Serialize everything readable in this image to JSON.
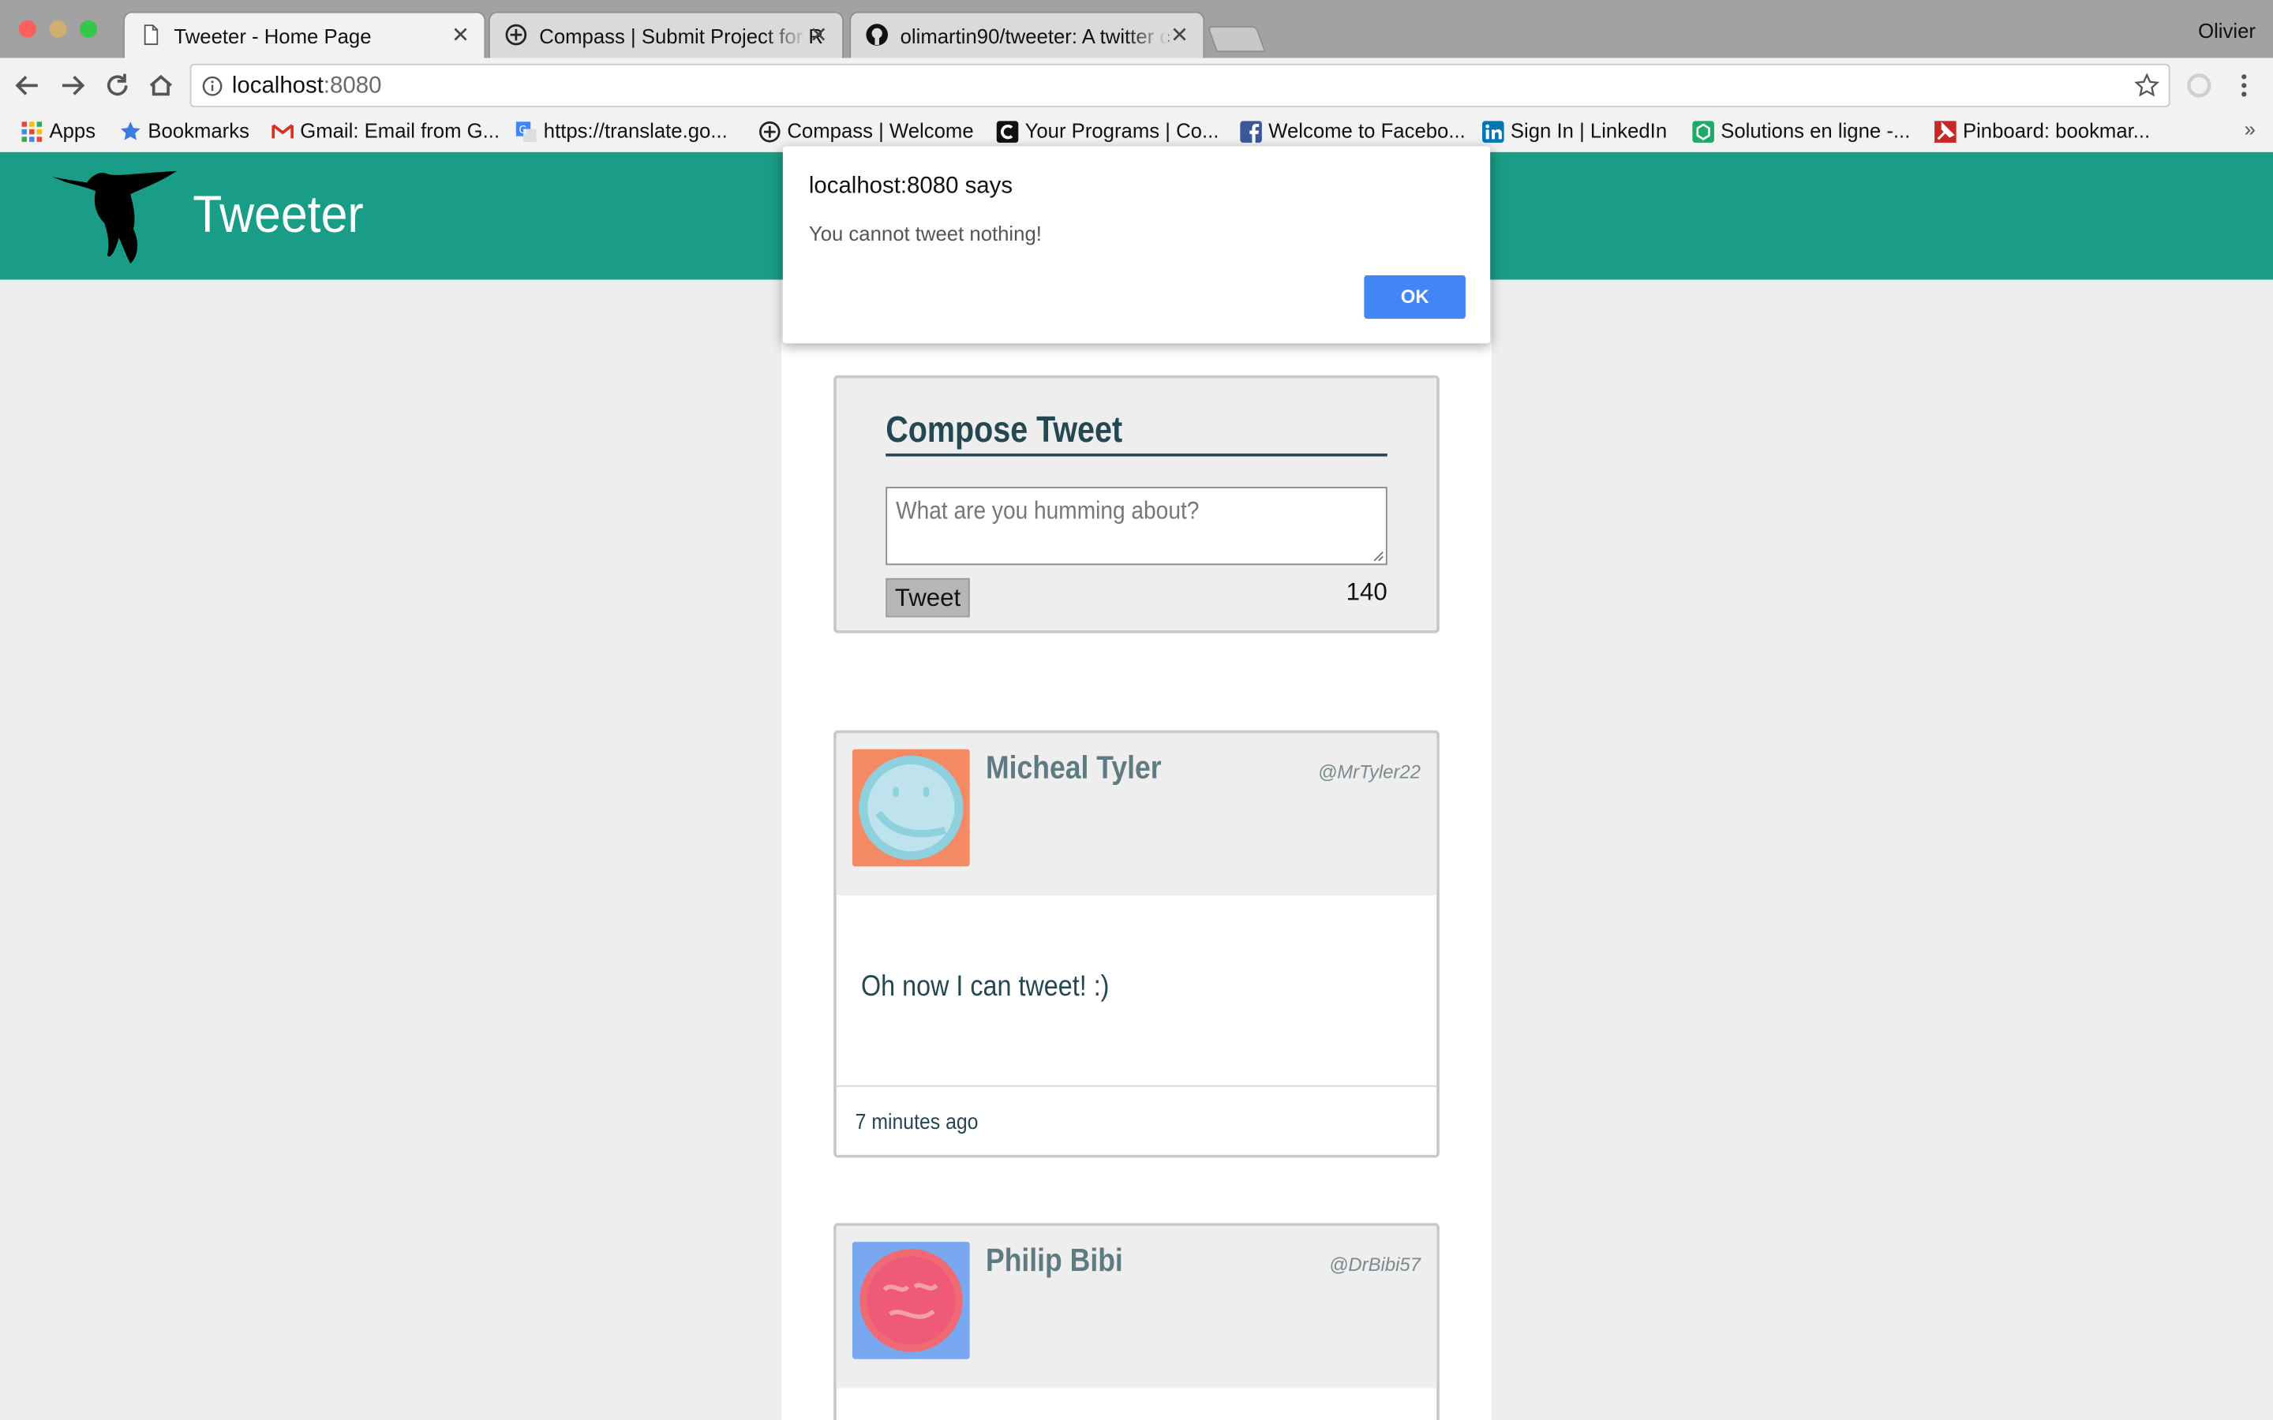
{
  "browser": {
    "profile_name": "Olivier",
    "tabs": [
      {
        "title": "Tweeter - Home Page",
        "active": true,
        "icon": "document-icon"
      },
      {
        "title": "Compass | Submit Project for R",
        "active": false,
        "icon": "compass-icon"
      },
      {
        "title": "olimartin90/tweeter: A twitter c",
        "active": false,
        "icon": "github-icon"
      }
    ],
    "url_host": "localhost",
    "url_port": ":8080",
    "bookmarks": [
      {
        "label": "Apps",
        "icon": "apps-grid-icon"
      },
      {
        "label": "Bookmarks",
        "icon": "star-icon"
      },
      {
        "label": "Gmail: Email from G...",
        "icon": "gmail-icon"
      },
      {
        "label": "https://translate.go...",
        "icon": "google-translate-icon"
      },
      {
        "label": "Compass | Welcome",
        "icon": "compass-icon"
      },
      {
        "label": "Your Programs | Co...",
        "icon": "coursera-icon"
      },
      {
        "label": "Welcome to Facebo...",
        "icon": "facebook-icon"
      },
      {
        "label": "Sign In | LinkedIn",
        "icon": "linkedin-icon"
      },
      {
        "label": "Solutions en ligne -...",
        "icon": "solutions-icon"
      },
      {
        "label": "Pinboard: bookmar...",
        "icon": "pinboard-icon"
      }
    ],
    "overflow_chevron": "»"
  },
  "app": {
    "brand": "Tweeter",
    "header_color": "#1a9d86"
  },
  "compose": {
    "title": "Compose Tweet",
    "placeholder": "What are you humming about?",
    "button_label": "Tweet",
    "counter": "140"
  },
  "tweets": [
    {
      "name": "Micheal Tyler",
      "handle": "@MrTyler22",
      "text": "Oh now I can tweet! :)",
      "time": "7 minutes ago"
    },
    {
      "name": "Philip Bibi",
      "handle": "@DrBibi57",
      "text": "",
      "time": ""
    }
  ],
  "dialog": {
    "title": "localhost:8080 says",
    "message": "You cannot tweet nothing!",
    "ok_label": "OK"
  }
}
